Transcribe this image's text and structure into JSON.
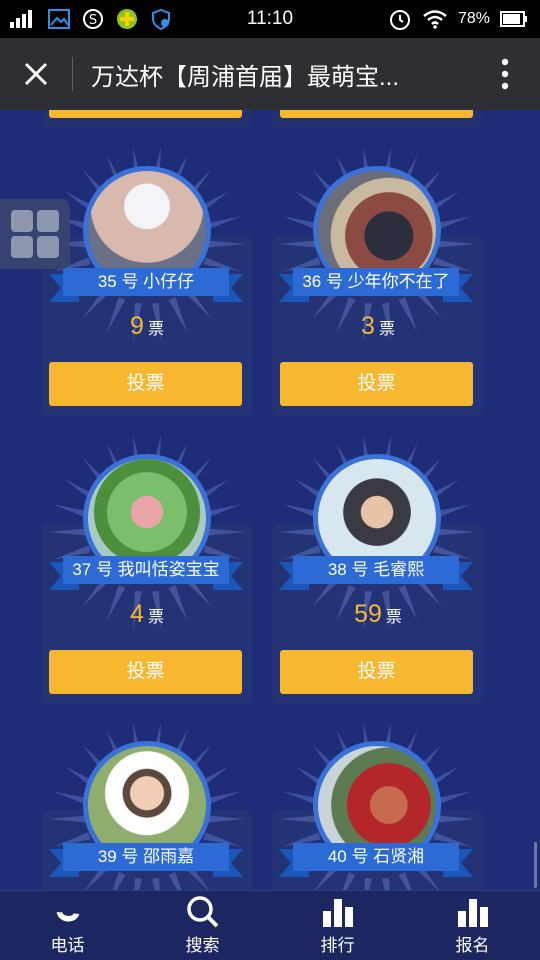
{
  "status_bar": {
    "time": "11:10",
    "battery": "78%"
  },
  "title_bar": {
    "title": "万达杯【周浦首届】最萌宝..."
  },
  "contestants": [
    {
      "label": "35 号 小仔仔",
      "votes": "9",
      "vote_unit": "票",
      "vote_button": "投票"
    },
    {
      "label": "36 号 少年你不在了",
      "votes": "3",
      "vote_unit": "票",
      "vote_button": "投票"
    },
    {
      "label": "37 号 我叫恬姿宝宝",
      "votes": "4",
      "vote_unit": "票",
      "vote_button": "投票"
    },
    {
      "label": "38 号 毛睿熙",
      "votes": "59",
      "vote_unit": "票",
      "vote_button": "投票"
    },
    {
      "label": "39 号 邵雨嘉"
    },
    {
      "label": "40 号 石贤湘"
    }
  ],
  "bottom_nav": [
    {
      "label": "电话",
      "icon": "phone-icon"
    },
    {
      "label": "搜索",
      "icon": "search-icon"
    },
    {
      "label": "排行",
      "icon": "ranking-icon"
    },
    {
      "label": "报名",
      "icon": "signup-icon"
    }
  ],
  "colors": {
    "accent": "#f7b731",
    "background": "#1f2c78",
    "ribbon": "#2c6bd6"
  }
}
